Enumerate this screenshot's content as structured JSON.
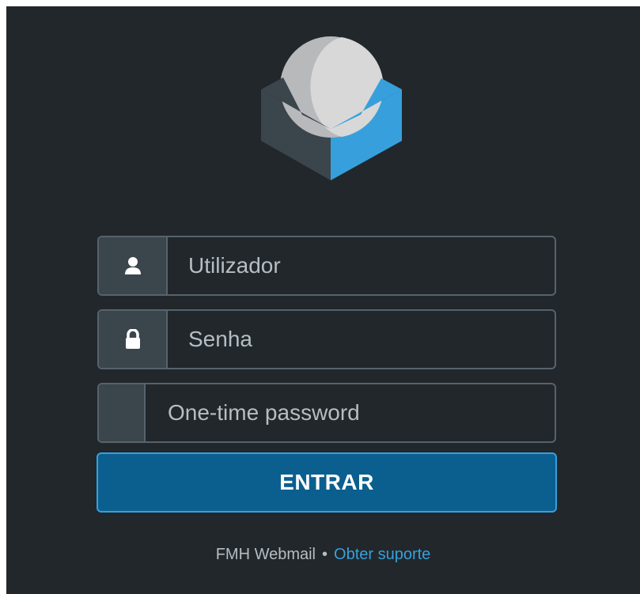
{
  "app": {
    "logo_icon": "roundcube-logo",
    "colors": {
      "background": "#22272b",
      "field_border": "#56636c",
      "addon_bg": "#3b454c",
      "accent": "#37a0dc",
      "button_bg": "#0b5f8f"
    }
  },
  "login": {
    "username": {
      "placeholder": "Utilizador",
      "value": "",
      "icon": "user-icon"
    },
    "password": {
      "placeholder": "Senha",
      "value": "",
      "icon": "lock-icon"
    },
    "otp": {
      "placeholder": "One-time password",
      "value": ""
    },
    "submit_label": "ENTRAR"
  },
  "footer": {
    "product": "FMH Webmail",
    "separator": "•",
    "support_link": "Obter suporte"
  }
}
